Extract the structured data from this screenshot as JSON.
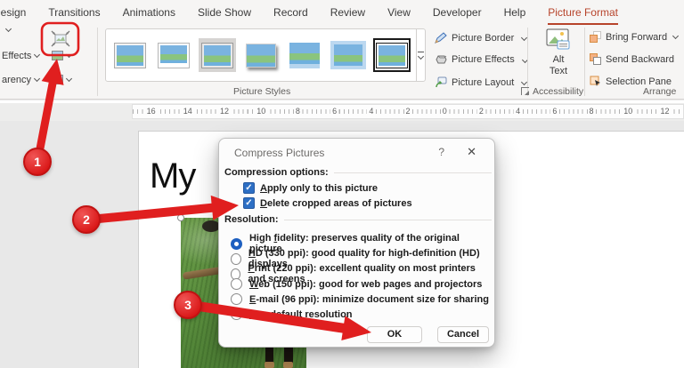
{
  "colors": {
    "accent_tab": "#b7432a",
    "annotation_red": "#e01f1f",
    "checkbox_blue": "#2d6fc4",
    "radio_blue": "#1d5fc0"
  },
  "tabs": [
    {
      "label": "Design"
    },
    {
      "label": "Transitions"
    },
    {
      "label": "Animations"
    },
    {
      "label": "Slide Show"
    },
    {
      "label": "Record"
    },
    {
      "label": "Review"
    },
    {
      "label": "View"
    },
    {
      "label": "Developer"
    },
    {
      "label": "Help"
    },
    {
      "label": "Picture Format",
      "active": true
    }
  ],
  "ribbon": {
    "adjust": {
      "artistic_effects_partial": "Effects",
      "transparency_partial": "arency"
    },
    "picture_styles_label": "Picture Styles",
    "tools": [
      {
        "label": "Picture Border"
      },
      {
        "label": "Picture Effects"
      },
      {
        "label": "Picture Layout"
      }
    ],
    "alt_text": {
      "line1": "Alt",
      "line2": "Text"
    },
    "accessibility_label": "Accessibility",
    "arrange": {
      "items": [
        {
          "label": "Bring Forward"
        },
        {
          "label": "Send Backward"
        },
        {
          "label": "Selection Pane"
        }
      ],
      "label": "Arrange"
    }
  },
  "ruler": {
    "numbers": [
      "16",
      "14",
      "12",
      "10",
      "8",
      "6",
      "4",
      "2",
      "0",
      "2",
      "4",
      "6",
      "8",
      "10",
      "12"
    ]
  },
  "slide": {
    "title_partial": "My"
  },
  "dialog": {
    "title": "Compress Pictures",
    "help_glyph": "?",
    "close_glyph": "✕",
    "check_glyph": "✓",
    "compression_section": "Compression options:",
    "checkboxes": [
      {
        "u": "A",
        "rest": "pply only to this picture",
        "checked": true
      },
      {
        "u": "D",
        "rest": "elete cropped areas of pictures",
        "checked": true
      }
    ],
    "resolution_section": "Resolution:",
    "radios": [
      {
        "pre": "High ",
        "u": "f",
        "rest": "idelity: preserves quality of the original picture",
        "selected": true
      },
      {
        "pre": "",
        "u": "H",
        "rest": "D (330 ppi): good quality for high-definition (HD) displays",
        "selected": false
      },
      {
        "pre": "",
        "u": "P",
        "rest": "rint (220 ppi): excellent quality on most printers and screens",
        "selected": false
      },
      {
        "pre": "",
        "u": "W",
        "rest": "eb (150 ppi): good for web pages and projectors",
        "selected": false
      },
      {
        "pre": "",
        "u": "E",
        "rest": "-mail (96 ppi): minimize document size for sharing",
        "selected": false
      },
      {
        "pre": "",
        "u": "U",
        "rest": "se default resolution",
        "selected": false
      }
    ],
    "ok_label": "OK",
    "cancel_label": "Cancel"
  },
  "annotations": {
    "steps": [
      "1",
      "2",
      "3"
    ]
  }
}
